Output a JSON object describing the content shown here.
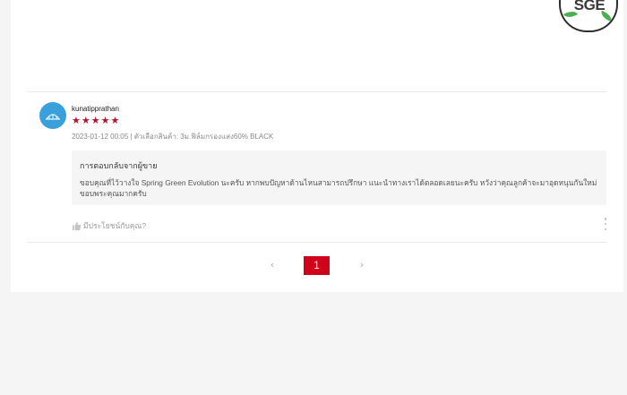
{
  "brand": {
    "logo_text": "SGE"
  },
  "review": {
    "username": "kunatipprathan",
    "rating_stars": "★★★★★",
    "rating": 5,
    "meta": "2023-01-12 00:05 | ตัวเลือกสินค้า: 3ม.ฟิล์มกรองแสง60% BLACK",
    "reply": {
      "title": "การตอบกลับจากผู้ขาย",
      "text": "ขอบคุณที่ไว้วางใจ Spring Green Evolution นะครับ หากพบปัญหาด้านไหนสามารถปรึกษา แนะนำทางเราได้ตลอดเลยนะครับ หวังว่าคุณลูกค้าจะมาอุดหนุนกันใหม่ ขอบพระคุณมากครับ"
    },
    "helpful_label": "มีประโยชน์กับคุณ?"
  },
  "pagination": {
    "prev": "‹",
    "current": "1",
    "next": "›"
  },
  "colors": {
    "accent": "#d0011b",
    "star": "#b5122b",
    "avatar": "#39a0dc"
  }
}
